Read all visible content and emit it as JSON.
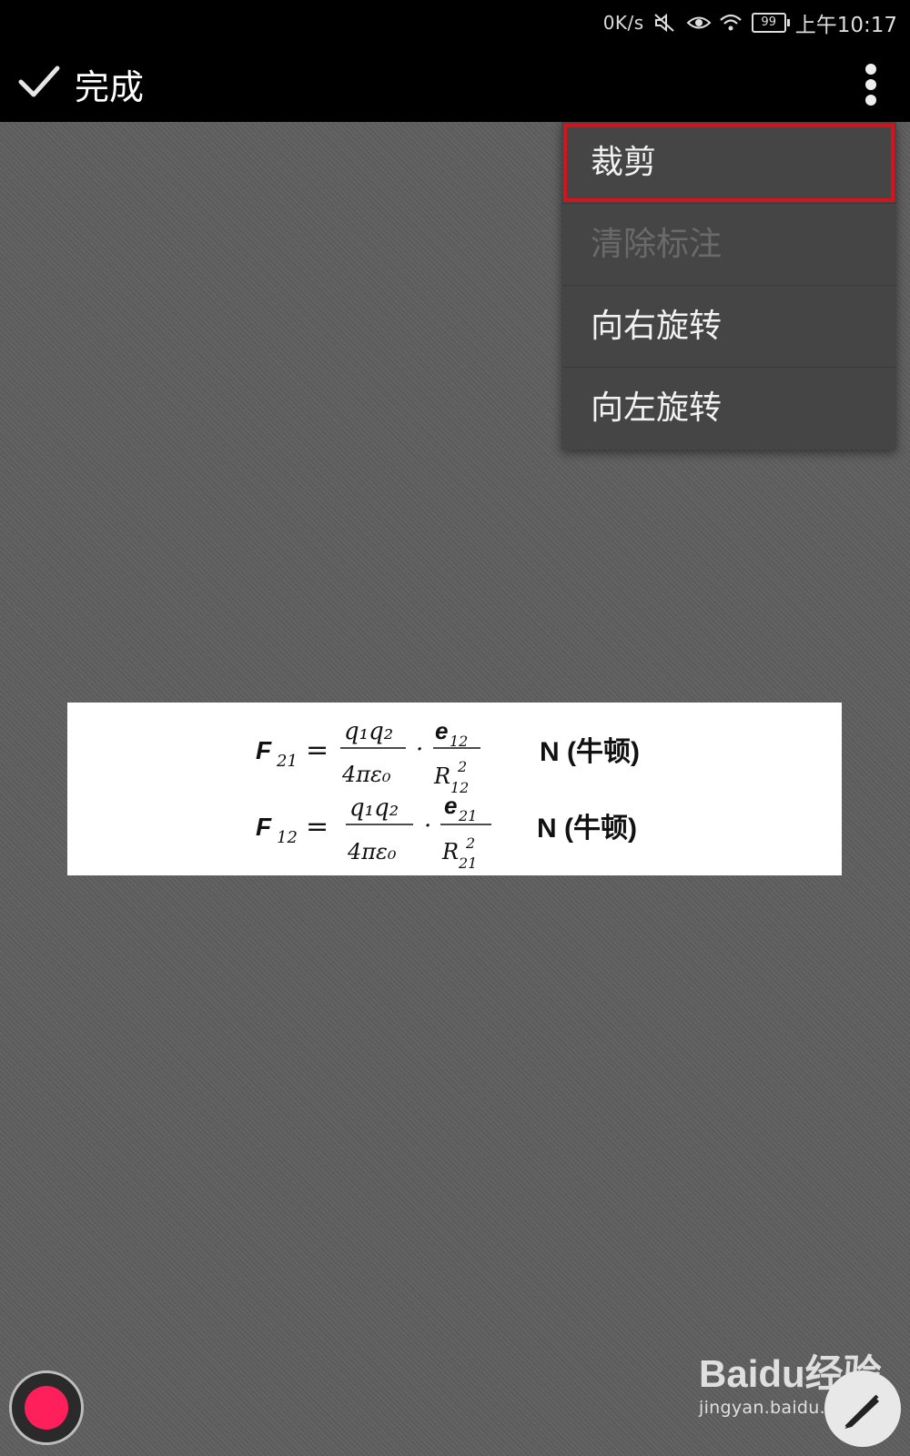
{
  "status_bar": {
    "net_speed": "0K/s",
    "battery_level": "99",
    "time": "上午10:17",
    "icons": [
      "mute-icon",
      "eye-icon",
      "wifi-icon",
      "battery-icon"
    ]
  },
  "action_bar": {
    "done_label": "完成",
    "icons": [
      "check-icon",
      "overflow-menu-icon"
    ]
  },
  "menu": {
    "items": [
      {
        "label": "裁剪",
        "enabled": true,
        "highlighted": true
      },
      {
        "label": "清除标注",
        "enabled": false,
        "highlighted": false
      },
      {
        "label": "向右旋转",
        "enabled": true,
        "highlighted": false
      },
      {
        "label": "向左旋转",
        "enabled": true,
        "highlighted": false
      }
    ],
    "highlight_color": "#d4141c"
  },
  "formula_image": {
    "line1": {
      "lhs": "F",
      "lhs_sub": "21",
      "num": "q₁q₂",
      "den": "4πε₀",
      "vec": "e",
      "vec_sub": "12",
      "r": "R",
      "r_sub": "12",
      "r_sup": "2",
      "unit": "N (牛顿)"
    },
    "line2": {
      "lhs": "F",
      "lhs_sub": "12",
      "num": "q₁q₂",
      "den": "4πε₀",
      "vec": "e",
      "vec_sub": "21",
      "r": "R",
      "r_sub": "21",
      "r_sup": "2",
      "unit": "N (牛顿)"
    }
  },
  "bottom": {
    "record_color": "#ff1f5a",
    "icons": [
      "record-icon",
      "pen-icon"
    ]
  },
  "watermark": {
    "logo": "Baidu经验",
    "url": "jingyan.baidu.com"
  }
}
